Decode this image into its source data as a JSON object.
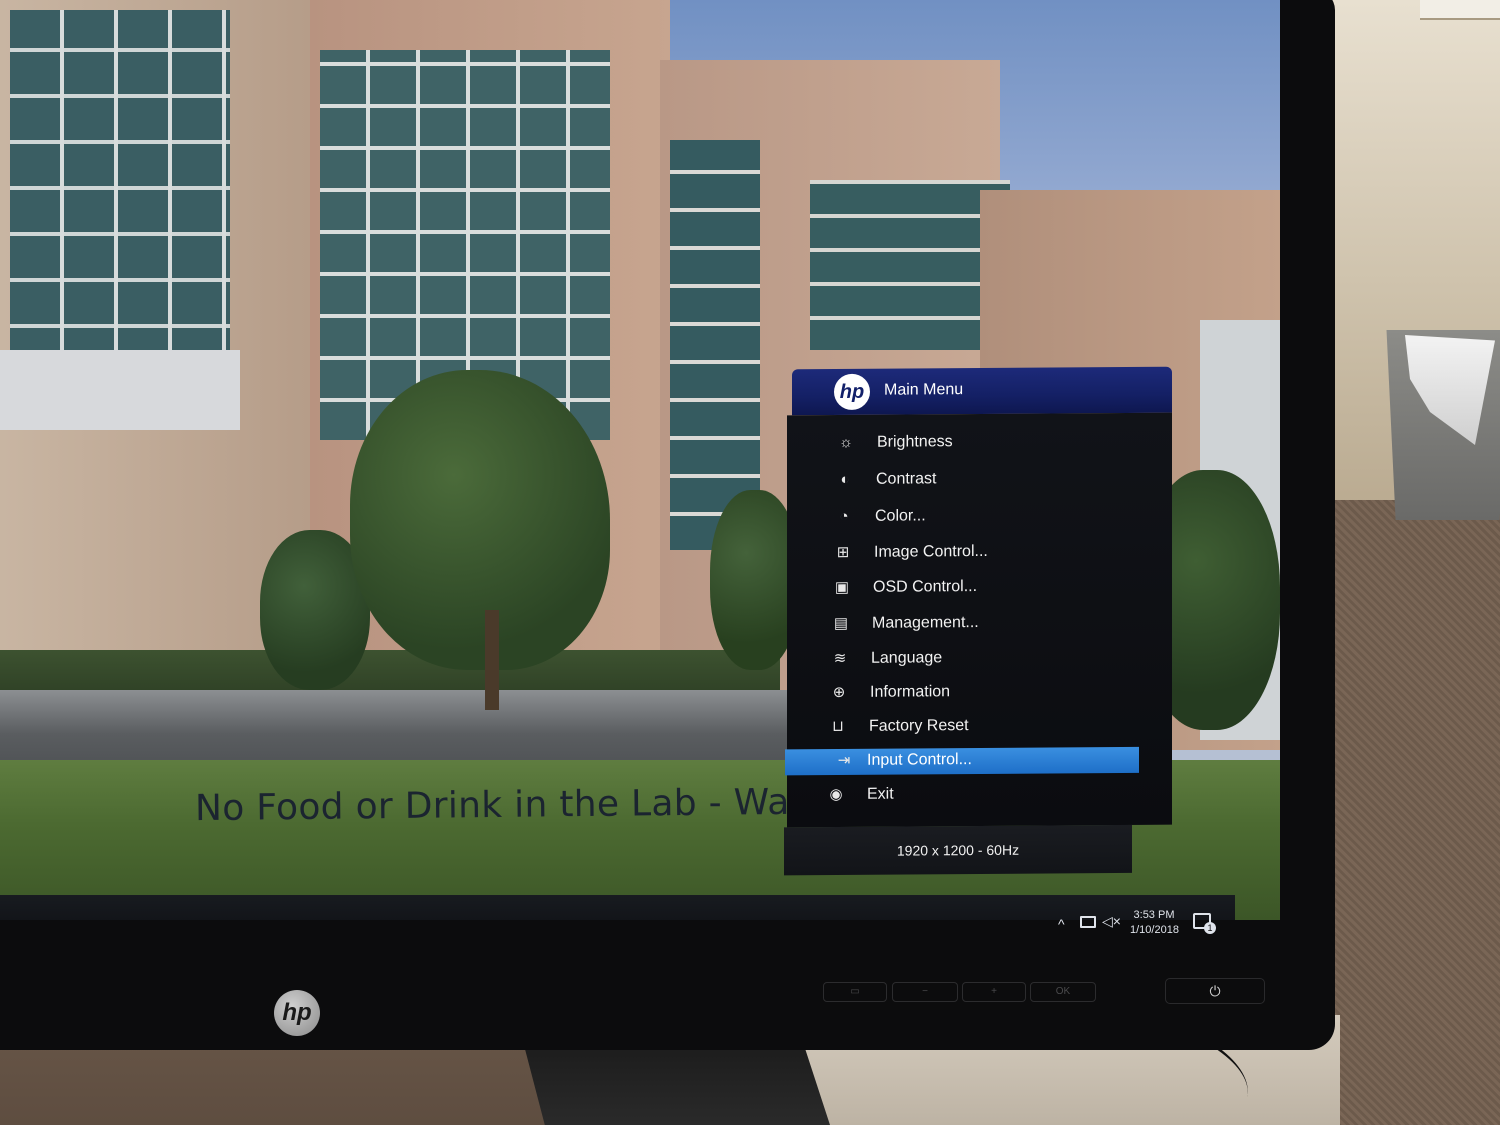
{
  "osd": {
    "title": "Main Menu",
    "logo": "hp",
    "items": [
      {
        "label": "Brightness",
        "icon": "sun-icon",
        "glyph": "☼"
      },
      {
        "label": "Contrast",
        "icon": "contrast-icon",
        "glyph": "◐"
      },
      {
        "label": "Color...",
        "icon": "palette-icon",
        "glyph": "◔"
      },
      {
        "label": "Image Control...",
        "icon": "image-control-icon",
        "glyph": "⊞"
      },
      {
        "label": "OSD Control...",
        "icon": "osd-control-icon",
        "glyph": "▣"
      },
      {
        "label": "Management...",
        "icon": "management-icon",
        "glyph": "▤"
      },
      {
        "label": "Language",
        "icon": "language-icon",
        "glyph": "≋"
      },
      {
        "label": "Information",
        "icon": "information-icon",
        "glyph": "⊕"
      },
      {
        "label": "Factory Reset",
        "icon": "factory-reset-icon",
        "glyph": "⊔"
      },
      {
        "label": "Input Control...",
        "icon": "input-control-icon",
        "glyph": "⇥"
      },
      {
        "label": "Exit",
        "icon": "exit-icon",
        "glyph": "◉"
      }
    ],
    "selected_index": 9,
    "status": "1920 x 1200 - 60Hz",
    "colors": {
      "header": "#142065",
      "selected": "#2b7fd6",
      "body": "#0e0f13"
    }
  },
  "wallpaper": {
    "text": "No Food or Drink in the Lab - Wa"
  },
  "taskbar": {
    "time": "3:53 PM",
    "date": "1/10/2018",
    "notification_count": "1"
  },
  "bezel": {
    "logo": "hp",
    "ok_label": "OK",
    "minus_label": "−",
    "plus_label": "+",
    "power_glyph": "⏻"
  }
}
